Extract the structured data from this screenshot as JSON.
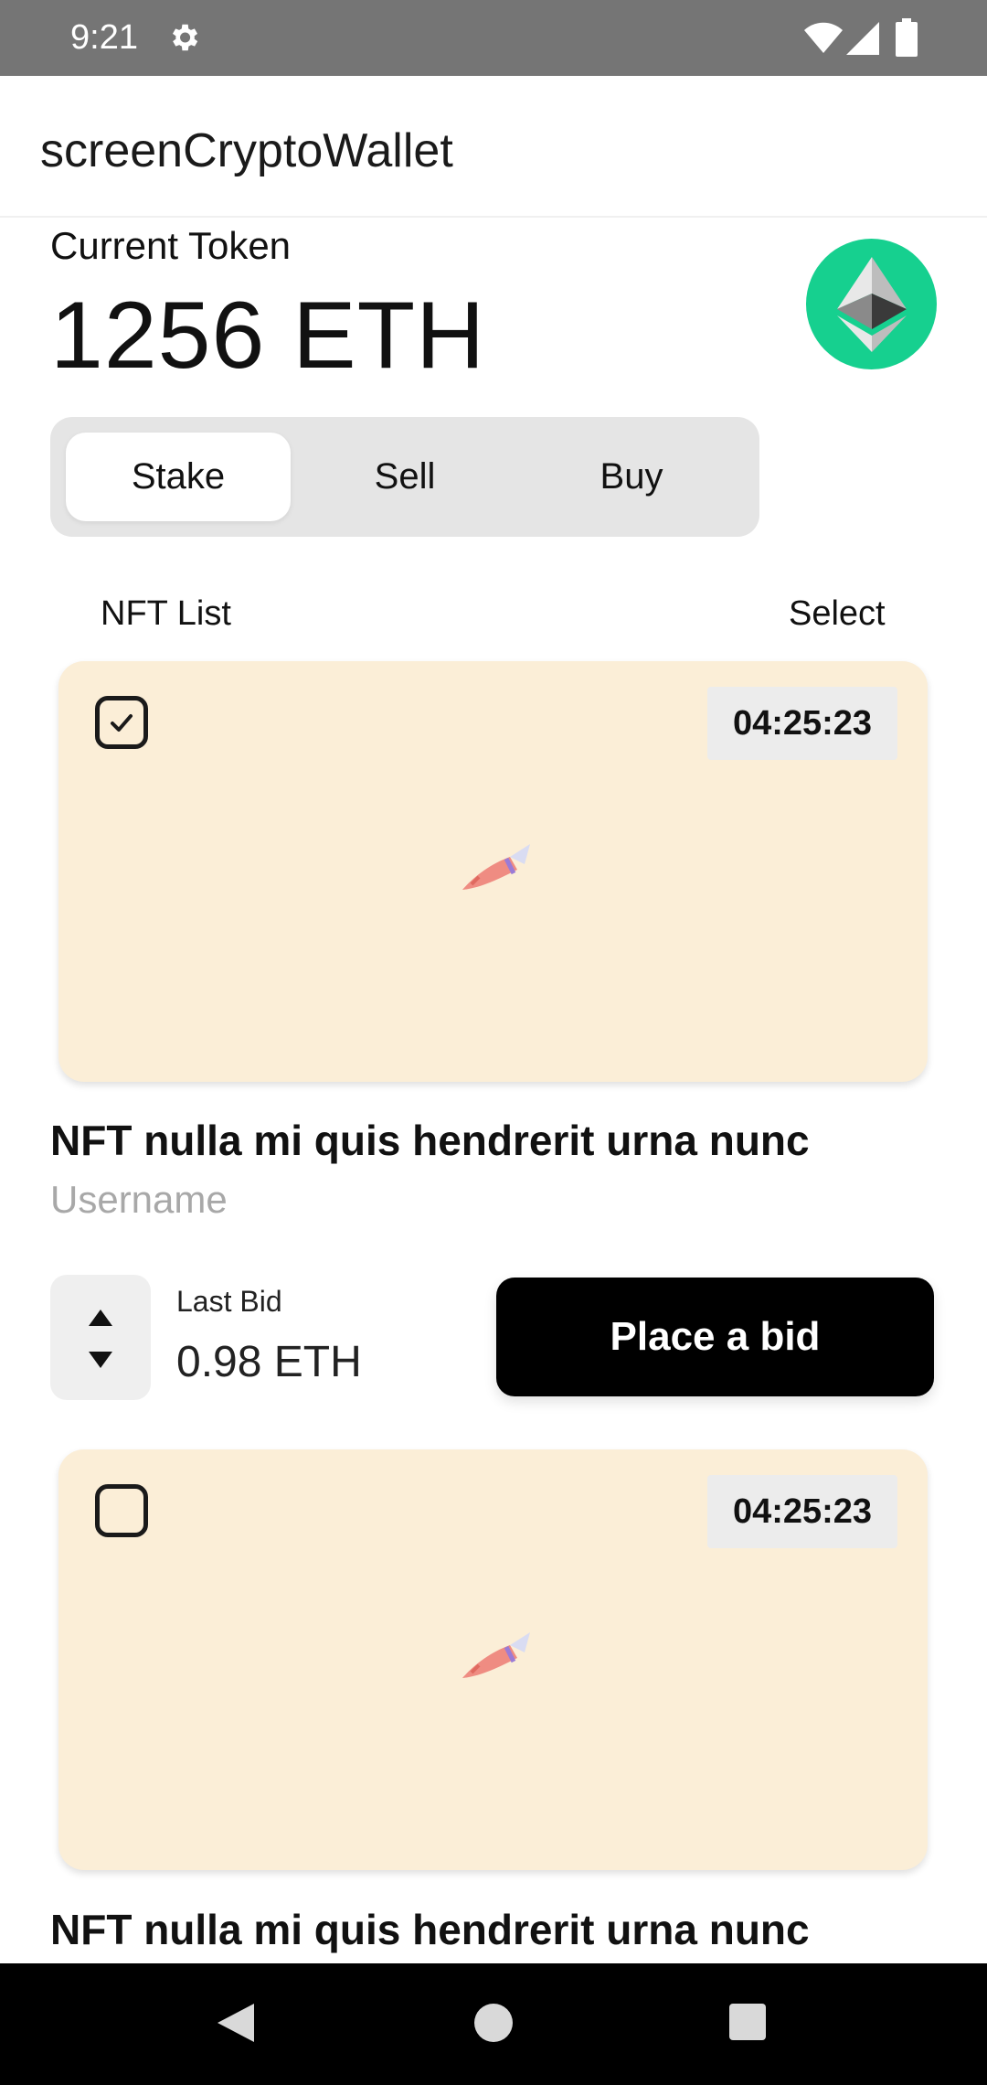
{
  "status_bar": {
    "time": "9:21",
    "icons": [
      "gear-icon",
      "wifi-icon",
      "signal-icon",
      "battery-icon"
    ]
  },
  "app_bar": {
    "title": "screenCryptoWallet"
  },
  "wallet": {
    "label": "Current Token",
    "balance": "1256 ETH",
    "token_icon": "ethereum-icon",
    "badge_color": "#16d08f"
  },
  "segments": {
    "items": [
      "Stake",
      "Sell",
      "Buy"
    ],
    "selected": "Stake"
  },
  "list": {
    "title": "NFT List",
    "select_label": "Select"
  },
  "nfts": [
    {
      "checked": true,
      "timer": "04:25:23",
      "image_icon": "rocket-icon",
      "title": "NFT nulla mi quis hendrerit urna nunc",
      "username": "Username",
      "last_bid_label": "Last Bid",
      "last_bid_value": "0.98 ETH",
      "action_label": "Place a bid"
    },
    {
      "checked": false,
      "timer": "04:25:23",
      "image_icon": "rocket-icon",
      "title": "NFT nulla mi quis hendrerit urna nunc"
    }
  ],
  "colors": {
    "card_background": "#fbeed7",
    "status_bar": "#757575",
    "primary_button": "#000000"
  },
  "nav_bar": {
    "icons": [
      "back-icon",
      "home-icon",
      "recents-icon"
    ]
  }
}
